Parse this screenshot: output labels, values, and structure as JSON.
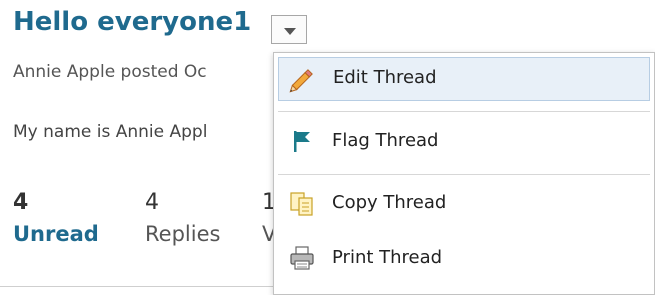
{
  "thread": {
    "title": "Hello everyone1",
    "meta": "Annie Apple posted Oc",
    "body": "My name is Annie Appl"
  },
  "stats": {
    "unread_count": "4",
    "unread_label": "Unread",
    "replies_count": "4",
    "replies_label": "Replies",
    "views_count_partial": "1",
    "views_label_partial": "V"
  },
  "menu": {
    "items": [
      {
        "label": "Edit Thread",
        "icon": "pencil-icon"
      },
      {
        "label": "Flag Thread",
        "icon": "flag-icon"
      },
      {
        "label": "Copy Thread",
        "icon": "copy-icon"
      },
      {
        "label": "Print Thread",
        "icon": "printer-icon"
      }
    ]
  },
  "colors": {
    "title": "#1f6a8e",
    "flag": "#1b7a8a",
    "highlight": "#e8f0f8"
  }
}
